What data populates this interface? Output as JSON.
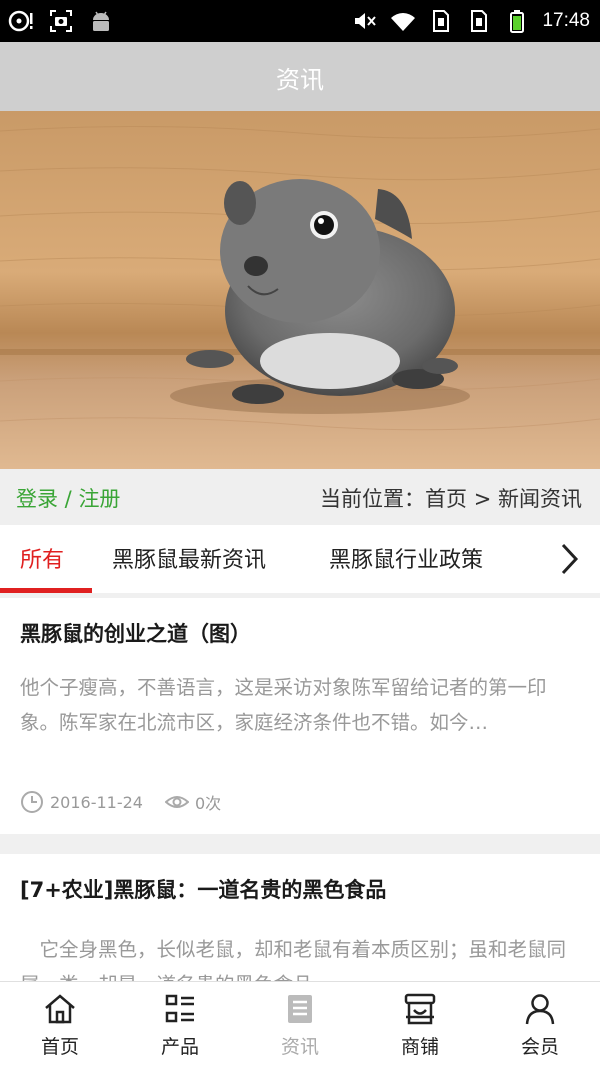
{
  "status_bar": {
    "time": "17:48"
  },
  "header": {
    "title": "资讯"
  },
  "account": {
    "login": "登录",
    "separator": " / ",
    "register": "注册"
  },
  "breadcrumb": {
    "label": "当前位置：",
    "home": "首页",
    "sep": " > ",
    "current": "新闻资讯"
  },
  "tabs": [
    {
      "label": "所有",
      "active": true
    },
    {
      "label": "黑豚鼠最新资讯",
      "active": false
    },
    {
      "label": "黑豚鼠行业政策",
      "active": false
    }
  ],
  "articles": [
    {
      "title": "黑豚鼠的创业之道（图）",
      "summary": "他个子瘦高，不善语言，这是采访对象陈军留给记者的第一印象。陈军家在北流市区，家庭经济条件也不错。如今…",
      "date": "2016-11-24",
      "views": "0次"
    },
    {
      "title": "[7+农业]黑豚鼠：一道名贵的黑色食品",
      "summary": "　它全身黑色，长似老鼠，却和老鼠有着本质区别；虽和老鼠同属一类，却是一道名贵的黑色食品"
    }
  ],
  "bottom_nav": [
    {
      "label": "首页",
      "icon": "home-icon"
    },
    {
      "label": "产品",
      "icon": "product-list-icon"
    },
    {
      "label": "资讯",
      "icon": "news-icon",
      "current": true
    },
    {
      "label": "商铺",
      "icon": "shop-icon"
    },
    {
      "label": "会员",
      "icon": "member-icon"
    }
  ],
  "colors": {
    "accent_red": "#e02020",
    "login_green": "#3aa536",
    "header_gray": "#cfcfcf"
  }
}
